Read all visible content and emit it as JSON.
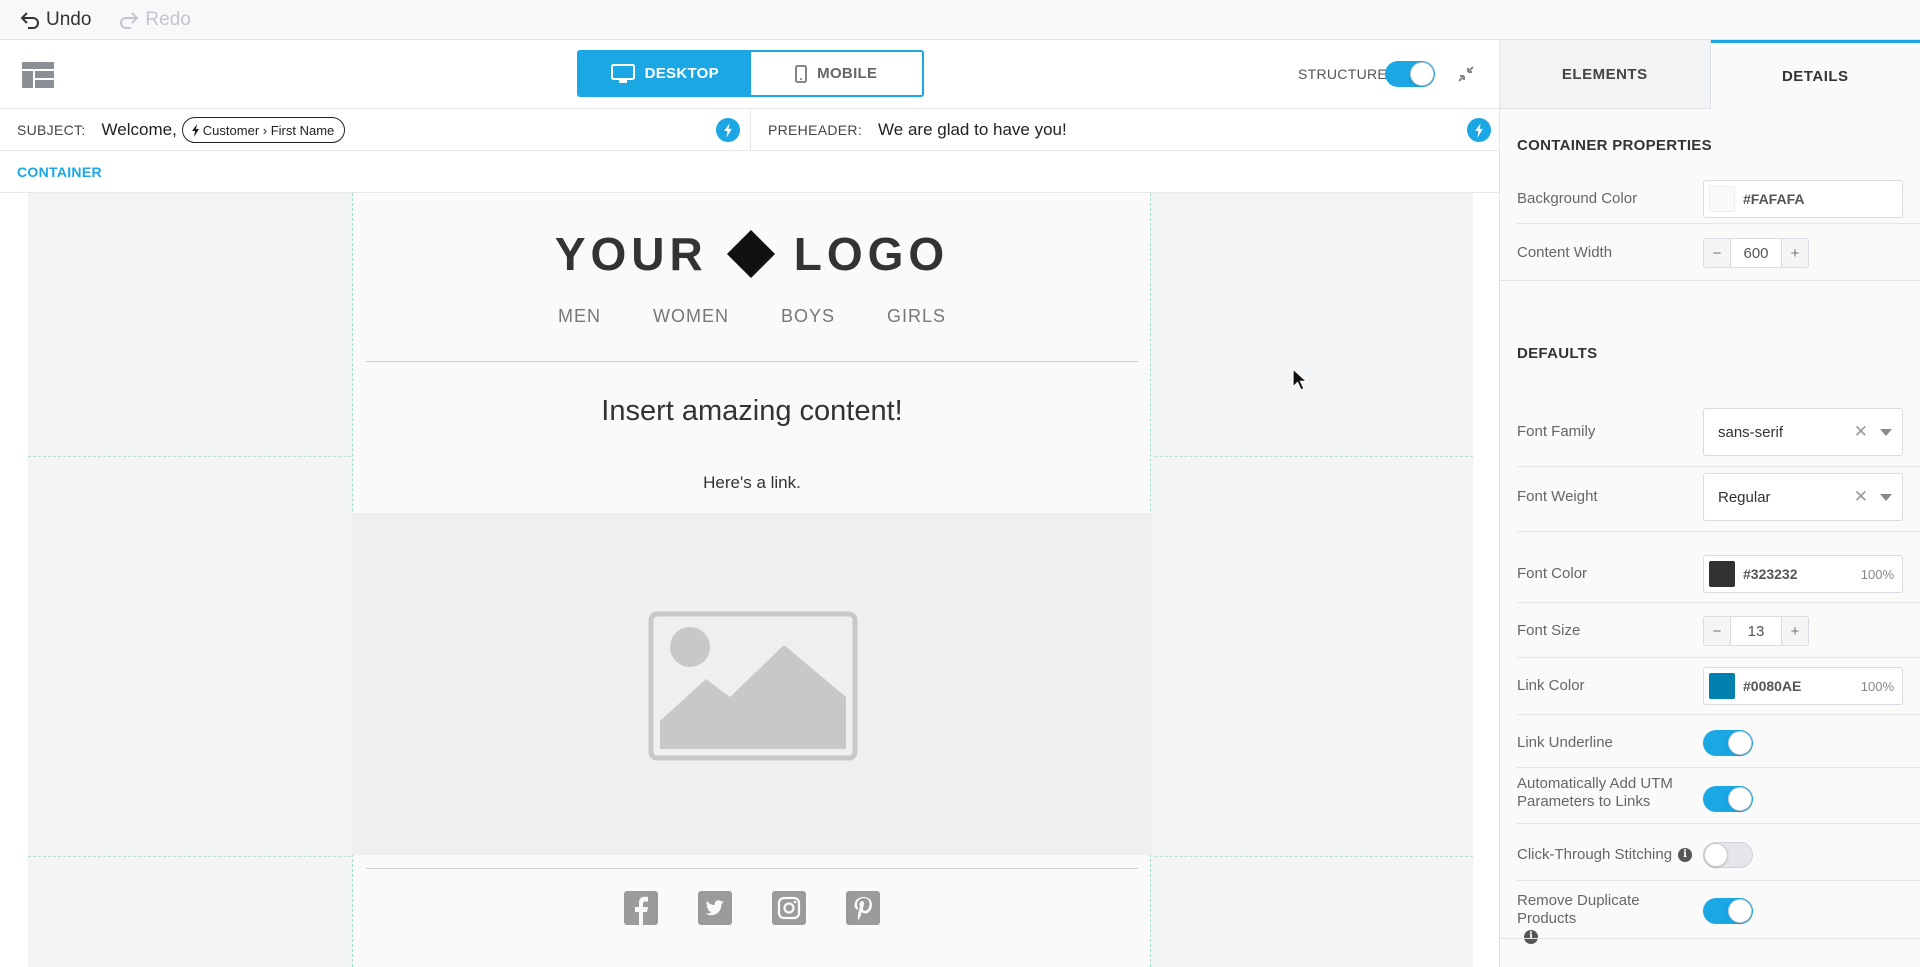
{
  "history": {
    "undo_label": "Undo",
    "redo_label": "Redo"
  },
  "toolbar": {
    "desktop_label": "DESKTOP",
    "mobile_label": "MOBILE",
    "structure_label": "STRUCTURE",
    "structure_on": true
  },
  "subject": {
    "label": "SUBJECT:",
    "text": "Welcome,",
    "token": "Customer › First Name"
  },
  "preheader": {
    "label": "PREHEADER:",
    "text": "We are glad to have you!"
  },
  "breadcrumb": "CONTAINER",
  "email": {
    "logo_left": "YOUR",
    "logo_right": "LOGO",
    "nav": [
      "MEN",
      "WOMEN",
      "BOYS",
      "GIRLS"
    ],
    "headline": "Insert amazing content!",
    "link_text": "Here's a link.",
    "socials": [
      "facebook-icon",
      "twitter-icon",
      "instagram-icon",
      "pinterest-icon"
    ]
  },
  "panel": {
    "tabs": [
      "ELEMENTS",
      "DETAILS"
    ],
    "active_tab": "DETAILS",
    "container_title": "CONTAINER PROPERTIES",
    "bg_color_label": "Background Color",
    "bg_color": "#FAFAFA",
    "content_width_label": "Content Width",
    "content_width": "600",
    "defaults_title": "DEFAULTS",
    "font_family_label": "Font Family",
    "font_family": "sans-serif",
    "font_weight_label": "Font Weight",
    "font_weight": "Regular",
    "font_color_label": "Font Color",
    "font_color": "#323232",
    "font_color_opacity": "100%",
    "font_size_label": "Font Size",
    "font_size": "13",
    "link_color_label": "Link Color",
    "link_color": "#0080AE",
    "link_color_opacity": "100%",
    "link_underline_label": "Link Underline",
    "link_underline": true,
    "utm_label": "Automatically Add UTM Parameters to Links",
    "utm": true,
    "click_through_label": "Click-Through Stitching",
    "click_through": false,
    "remove_dup_label": "Remove Duplicate Products",
    "remove_dup": true
  },
  "colors": {
    "accent": "#1aa7e4",
    "font": "#323232",
    "link": "#0080AE",
    "background": "#FAFAFA"
  }
}
